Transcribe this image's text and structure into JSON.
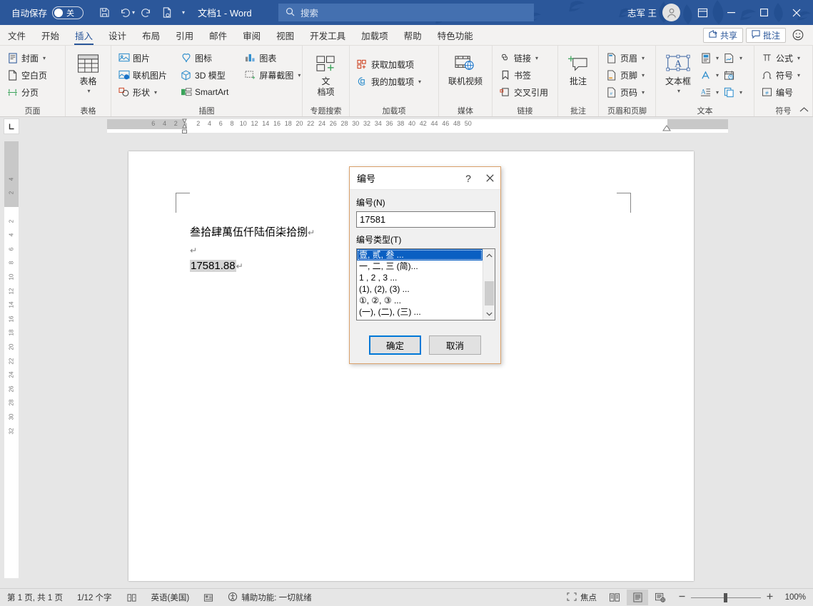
{
  "titlebar": {
    "autosave_label": "自动保存",
    "autosave_state": "关",
    "save_icon": "save-icon",
    "undo_icon": "undo-icon",
    "redo_icon": "redo-icon",
    "print_icon": "print-preview-icon",
    "customize_icon": "customize-quick-access-icon",
    "document_title": "文档1  -  Word",
    "search_placeholder": "搜索",
    "search_icon": "search-icon",
    "username": "志军 王",
    "avatar_icon": "user-avatar-icon",
    "ribbon_display_icon": "ribbon-display-options-icon",
    "minimize_icon": "minimize-icon",
    "maximize_icon": "maximize-icon",
    "close_icon": "close-icon"
  },
  "tabs": [
    {
      "label": "文件",
      "active": false
    },
    {
      "label": "开始",
      "active": false
    },
    {
      "label": "插入",
      "active": true
    },
    {
      "label": "设计",
      "active": false
    },
    {
      "label": "布局",
      "active": false
    },
    {
      "label": "引用",
      "active": false
    },
    {
      "label": "邮件",
      "active": false
    },
    {
      "label": "审阅",
      "active": false
    },
    {
      "label": "视图",
      "active": false
    },
    {
      "label": "开发工具",
      "active": false
    },
    {
      "label": "加载项",
      "active": false
    },
    {
      "label": "帮助",
      "active": false
    },
    {
      "label": "特色功能",
      "active": false
    }
  ],
  "tabstrip_right": {
    "share_label": "共享",
    "share_icon": "share-icon",
    "comment_label": "批注",
    "comment_icon": "comment-icon",
    "feedback_icon": "smiley-face-icon"
  },
  "ribbon": {
    "groups": [
      {
        "label": "页面",
        "items": [
          {
            "label": "封面",
            "icon": "cover-page-icon",
            "caret": true
          },
          {
            "label": "空白页",
            "icon": "blank-page-icon",
            "caret": false
          },
          {
            "label": "分页",
            "icon": "page-break-icon",
            "caret": false
          }
        ]
      },
      {
        "label": "表格",
        "big": {
          "label": "表格",
          "icon": "table-icon",
          "caret": true
        }
      },
      {
        "label": "插图",
        "items": [
          {
            "label": "图片",
            "icon": "picture-icon",
            "caret": false
          },
          {
            "label": "联机图片",
            "icon": "online-pictures-icon",
            "caret": false
          },
          {
            "label": "形状",
            "icon": "shapes-icon",
            "caret": true
          },
          {
            "label": "图标",
            "icon": "icons-icon",
            "caret": false
          },
          {
            "label": "3D 模型",
            "icon": "3d-model-icon",
            "caret": false
          },
          {
            "label": "SmartArt",
            "icon": "smartart-icon",
            "caret": false
          },
          {
            "label": "图表",
            "icon": "chart-icon",
            "caret": false
          },
          {
            "label": "屏幕截图",
            "icon": "screenshot-icon",
            "caret": true
          }
        ]
      },
      {
        "label": "专题搜索",
        "big": {
          "label": "文\n档项",
          "icon": "document-items-icon",
          "caret": false
        }
      },
      {
        "label": "加载项",
        "items": [
          {
            "label": "获取加载项",
            "icon": "get-addins-icon",
            "caret": false
          },
          {
            "label": "我的加载项",
            "icon": "my-addins-icon",
            "caret": true
          }
        ]
      },
      {
        "label": "媒体",
        "big": {
          "label": "联机视频",
          "icon": "online-video-icon",
          "caret": false
        }
      },
      {
        "label": "链接",
        "items": [
          {
            "label": "链接",
            "icon": "link-icon",
            "caret": true
          },
          {
            "label": "书签",
            "icon": "bookmark-icon",
            "caret": false
          },
          {
            "label": "交叉引用",
            "icon": "cross-reference-icon",
            "caret": false
          }
        ]
      },
      {
        "label": "批注",
        "big": {
          "label": "批注",
          "icon": "new-comment-icon",
          "caret": false
        }
      },
      {
        "label": "页眉和页脚",
        "items": [
          {
            "label": "页眉",
            "icon": "header-icon",
            "caret": true
          },
          {
            "label": "页脚",
            "icon": "footer-icon",
            "caret": true
          },
          {
            "label": "页码",
            "icon": "page-number-icon",
            "caret": true
          }
        ]
      },
      {
        "label": "文本",
        "big": {
          "label": "文本框",
          "icon": "text-box-icon",
          "caret": true
        },
        "items": [
          {
            "label": "",
            "icon": "quick-parts-icon",
            "caret": true
          },
          {
            "label": "",
            "icon": "wordart-icon",
            "caret": true
          },
          {
            "label": "",
            "icon": "drop-cap-icon",
            "caret": true
          },
          {
            "label": "",
            "icon": "signature-line-icon",
            "caret": true
          },
          {
            "label": "",
            "icon": "date-time-icon",
            "caret": false
          },
          {
            "label": "",
            "icon": "object-icon",
            "caret": true
          }
        ]
      },
      {
        "label": "符号",
        "items": [
          {
            "label": "公式",
            "icon": "equation-icon",
            "caret": true
          },
          {
            "label": "符号",
            "icon": "symbol-icon",
            "caret": true
          },
          {
            "label": "编号",
            "icon": "number-icon",
            "caret": false
          }
        ]
      }
    ],
    "collapse_icon": "collapse-ribbon-icon"
  },
  "ruler": {
    "tab_selector_icon": "left-tab-stop-icon",
    "h_left_margin_nums": [
      "6",
      "4",
      "2"
    ],
    "h_nums": [
      "2",
      "4",
      "6",
      "8",
      "10",
      "12",
      "14",
      "16",
      "18",
      "20",
      "22",
      "24",
      "26",
      "28",
      "30",
      "32",
      "34",
      "36",
      "38",
      "40",
      "42"
    ],
    "h_right_margin_nums": [
      "44",
      "46",
      "48",
      "50"
    ],
    "v_margin_nums": [
      "4",
      "2"
    ],
    "v_nums": [
      "2",
      "4",
      "6",
      "8",
      "10",
      "12",
      "14",
      "16",
      "18",
      "20",
      "22",
      "24",
      "26",
      "28",
      "30",
      "32"
    ]
  },
  "document": {
    "line1": "叁拾肆萬伍仟陆佰柒拾捌",
    "line2": "",
    "line3": "17581.88",
    "pilcrow": "↵"
  },
  "dialog": {
    "title": "编号",
    "help_icon": "help-question-icon",
    "close_icon": "dialog-close-icon",
    "number_label": "编号(N)",
    "number_value": "17581",
    "type_label": "编号类型(T)",
    "list_items": [
      {
        "text": "壹, 贰, 叁 ...",
        "selected": true
      },
      {
        "text": "一, 二, 三 (简)...",
        "selected": false
      },
      {
        "text": "1 , 2 , 3  ...",
        "selected": false
      },
      {
        "text": "(1), (2), (3) ...",
        "selected": false
      },
      {
        "text": "①, ②, ③ ...",
        "selected": false
      },
      {
        "text": "(一), (二), (三) ...",
        "selected": false
      }
    ],
    "scroll_up_icon": "scroll-up-arrow-icon",
    "scroll_down_icon": "scroll-down-arrow-icon",
    "ok_label": "确定",
    "cancel_label": "取消"
  },
  "statusbar": {
    "page_info": "第 1 页, 共 1 页",
    "word_count": "1/12 个字",
    "proofing_icon": "proofing-errors-icon",
    "language": "英语(美国)",
    "track_changes_icon": "track-changes-icon",
    "accessibility_icon": "accessibility-icon",
    "accessibility_text": "辅助功能: 一切就绪",
    "focus_label": "焦点",
    "focus_icon": "focus-mode-icon",
    "read_mode_icon": "read-mode-icon",
    "print_layout_icon": "print-layout-icon",
    "web_layout_icon": "web-layout-icon",
    "zoom_out_icon": "zoom-out-icon",
    "zoom_in_icon": "zoom-in-icon",
    "zoom_level": "100%"
  },
  "colors": {
    "titlebar": "#2b579a",
    "accent": "#2b579a",
    "dialog_border": "#d9a06a",
    "selection": "#0a5fc2"
  }
}
